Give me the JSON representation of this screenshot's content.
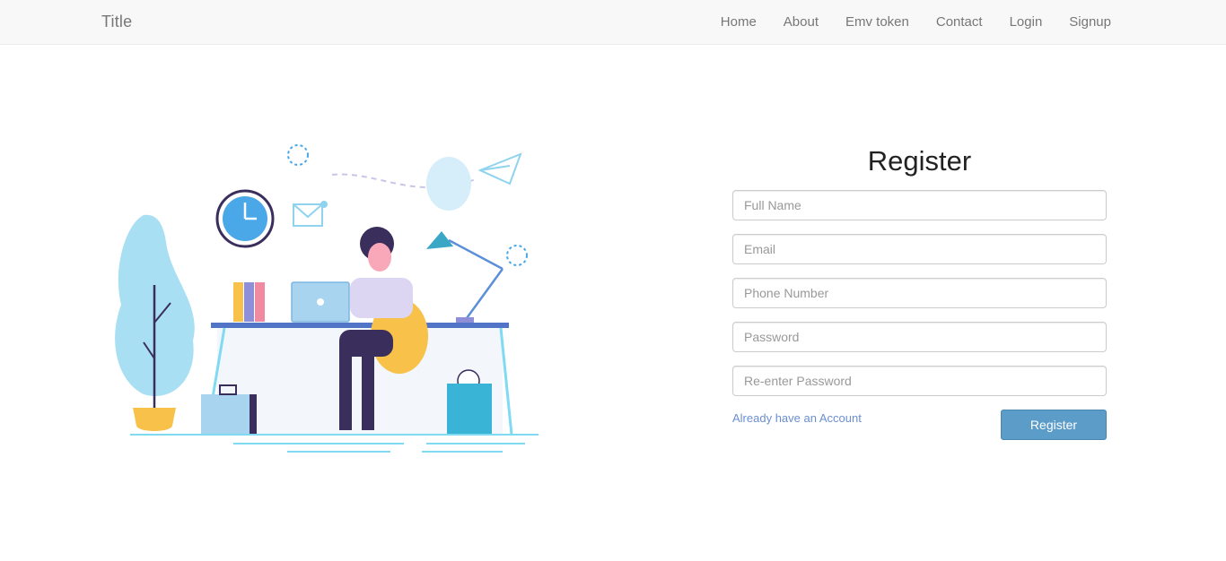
{
  "navbar": {
    "brand": "Title",
    "links": [
      "Home",
      "About",
      "Emv token",
      "Contact",
      "Login",
      "Signup"
    ]
  },
  "form": {
    "title": "Register",
    "fields": {
      "full_name": "Full Name",
      "email": "Email",
      "phone": "Phone Number",
      "password": "Password",
      "repassword": "Re-enter Password"
    },
    "login_link": "Already have an Account",
    "submit": "Register"
  },
  "colors": {
    "accent": "#5b9cc8",
    "link": "#6a8fd0",
    "navbar_bg": "#f8f8f8"
  }
}
